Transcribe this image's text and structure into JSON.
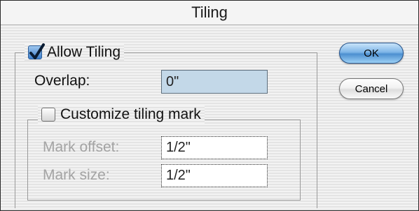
{
  "dialog": {
    "title": "Tiling",
    "allow_tiling": {
      "label": "Allow Tiling",
      "checked": true
    },
    "overlap": {
      "label": "Overlap:",
      "value": "0\""
    },
    "customize": {
      "label": "Customize tiling mark",
      "checked": false,
      "mark_offset": {
        "label": "Mark offset:",
        "value": "1/2\""
      },
      "mark_size": {
        "label": "Mark size:",
        "value": "1/2\""
      }
    },
    "buttons": {
      "ok": "OK",
      "cancel": "Cancel"
    }
  },
  "colors": {
    "ok_button": "#6aa5de",
    "focused_field": "#c3d8e8",
    "disabled_text": "#a3a3a3"
  },
  "icons": {
    "checkbox_checked": "checkmark-icon"
  }
}
